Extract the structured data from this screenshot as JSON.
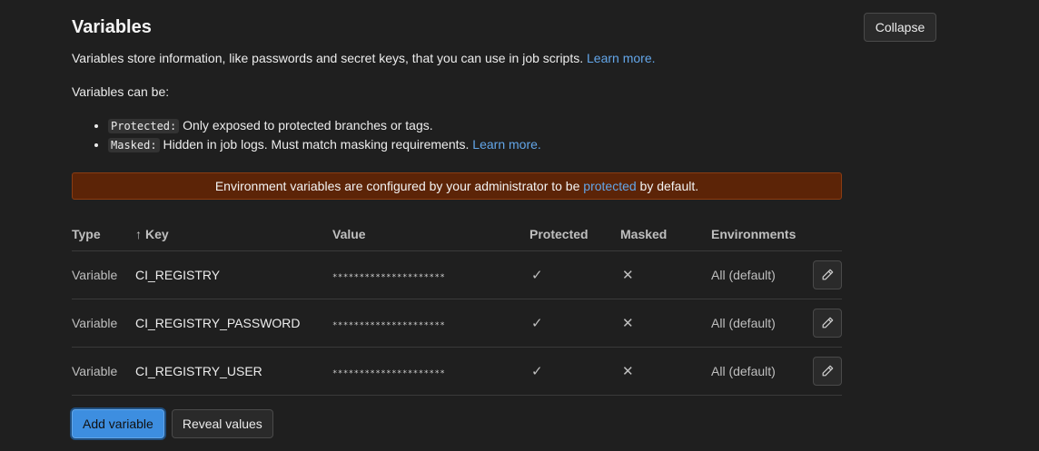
{
  "section": {
    "title": "Variables",
    "collapse_label": "Collapse",
    "description": "Variables store information, like passwords and secret keys, that you can use in job scripts.",
    "learn_more": "Learn more.",
    "can_be": "Variables can be:",
    "types": [
      {
        "code": "Protected:",
        "text": "Only exposed to protected branches or tags.",
        "link": ""
      },
      {
        "code": "Masked:",
        "text": "Hidden in job logs. Must match masking requirements.",
        "link": "Learn more."
      }
    ]
  },
  "alert": {
    "prefix": "Environment variables are configured by your administrator to be",
    "link": "protected",
    "suffix": "by default.",
    "background": "#5c2407"
  },
  "table": {
    "headers": {
      "type": "Type",
      "key": "Key",
      "value": "Value",
      "protected": "Protected",
      "masked": "Masked",
      "environments": "Environments"
    },
    "rows": [
      {
        "type": "Variable",
        "key": "CI_REGISTRY",
        "value": "*********************",
        "protected": "✓",
        "masked": "✕",
        "env": "All (default)"
      },
      {
        "type": "Variable",
        "key": "CI_REGISTRY_PASSWORD",
        "value": "*********************",
        "protected": "✓",
        "masked": "✕",
        "env": "All (default)"
      },
      {
        "type": "Variable",
        "key": "CI_REGISTRY_USER",
        "value": "*********************",
        "protected": "✓",
        "masked": "✕",
        "env": "All (default)"
      }
    ]
  },
  "actions": {
    "add_label": "Add variable",
    "reveal_label": "Reveal values"
  },
  "icons": {
    "sort": "arrow-up-icon",
    "protected": "check-icon",
    "masked": "close-icon",
    "edit": "pencil-icon"
  },
  "colors": {
    "link": "#63a6e9",
    "primary": "#3d8ee0",
    "background": "#1f1f1f"
  }
}
